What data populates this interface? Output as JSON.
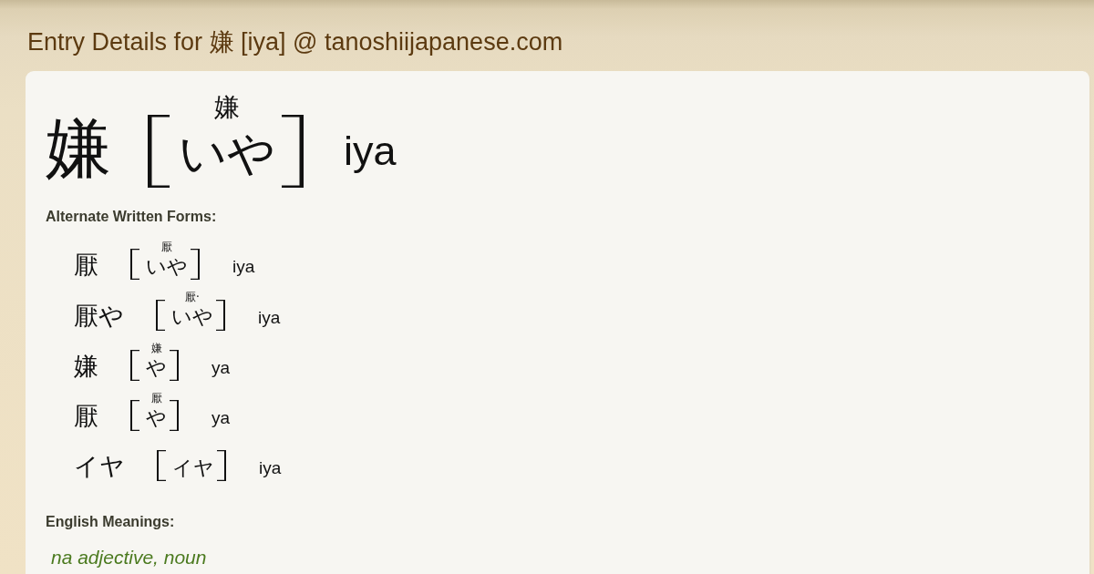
{
  "title": "Entry Details for 嫌 [iya] @ tanoshiijapanese.com",
  "entry": {
    "written": "嫌",
    "furigana": "嫌",
    "reading": "いや",
    "romaji": "iya"
  },
  "alternate_forms": {
    "heading": "Alternate Written Forms:",
    "forms": [
      {
        "written": "厭",
        "furigana": "厭",
        "reading": "いや",
        "romaji": "iya"
      },
      {
        "written": "厭や",
        "furigana": "厭·",
        "reading": "いや",
        "romaji": "iya"
      },
      {
        "written": "嫌",
        "furigana": "嫌",
        "reading": "や",
        "romaji": "ya"
      },
      {
        "written": "厭",
        "furigana": "厭",
        "reading": "や",
        "romaji": "ya"
      },
      {
        "written": "イヤ",
        "reading": "イヤ",
        "romaji": "iya"
      }
    ]
  },
  "meanings": {
    "heading": "English Meanings:",
    "text": "na adjective, noun"
  }
}
